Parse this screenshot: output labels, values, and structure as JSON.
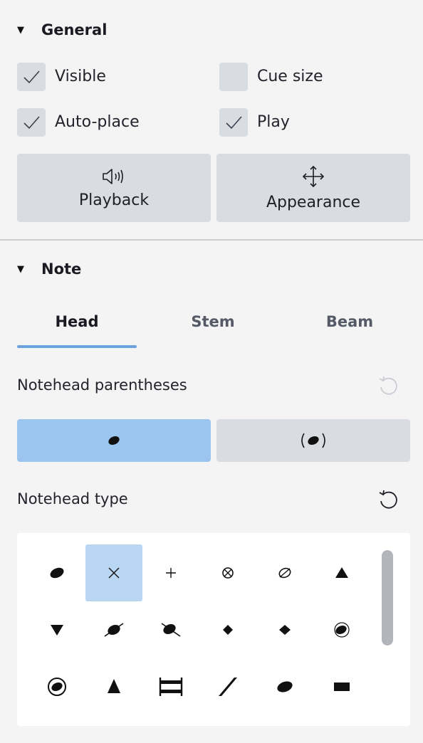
{
  "general": {
    "title": "General",
    "checkboxes": [
      {
        "label": "Visible",
        "checked": true
      },
      {
        "label": "Cue size",
        "checked": false
      },
      {
        "label": "Auto-place",
        "checked": true
      },
      {
        "label": "Play",
        "checked": true
      }
    ],
    "buttons": [
      {
        "label": "Playback",
        "icon": "speaker-icon"
      },
      {
        "label": "Appearance",
        "icon": "move-arrows-icon"
      }
    ]
  },
  "note": {
    "title": "Note",
    "tabs": [
      {
        "label": "Head",
        "active": true
      },
      {
        "label": "Stem",
        "active": false
      },
      {
        "label": "Beam",
        "active": false
      }
    ],
    "parentheses": {
      "label": "Notehead parentheses",
      "options": [
        {
          "name": "no-parentheses",
          "selected": true
        },
        {
          "name": "parentheses",
          "selected": false
        }
      ]
    },
    "notehead_type": {
      "label": "Notehead type",
      "selected_index": 1,
      "types": [
        "normal",
        "cross",
        "plus",
        "circle-cross",
        "with-x",
        "triangle-up",
        "triangle-down",
        "slashed-forwards",
        "slashed-backwards",
        "diamond",
        "diamond-old",
        "circled",
        "circled-large",
        "large-arrow",
        "brevis-alt",
        "slash",
        "la",
        "square"
      ]
    }
  },
  "colors": {
    "accent": "#6ba4dd",
    "selected_segment": "#9bc4ee",
    "selected_cell": "#b9d7f3",
    "button_bg": "#d9dde2",
    "panel_bg": "#f4f4f4"
  }
}
